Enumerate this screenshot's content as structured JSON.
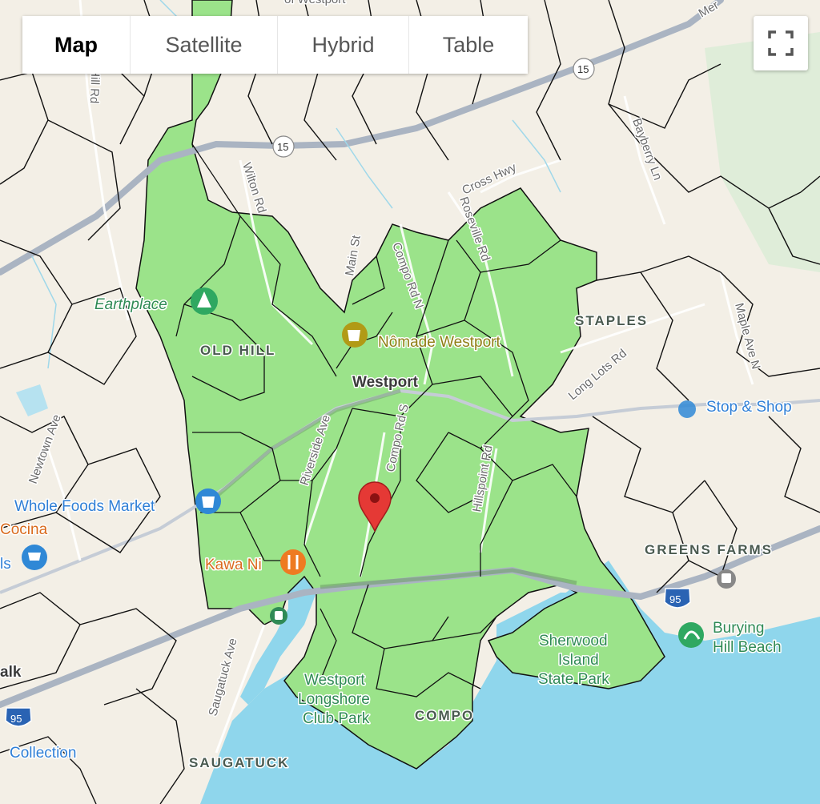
{
  "map_type_control": {
    "tabs": [
      {
        "label": "Map",
        "active": true
      },
      {
        "label": "Satellite",
        "active": false
      },
      {
        "label": "Hybrid",
        "active": false
      },
      {
        "label": "Table",
        "active": false
      }
    ]
  },
  "fullscreen": {
    "icon": "fullscreen-icon"
  },
  "colors": {
    "land": "#f3efe6",
    "water": "#8fd6ec",
    "selected_region": "#9be38a",
    "boundary": "#111111",
    "highway": "#aab4c2",
    "marker": "#e53935",
    "poi_blue": "#2f7fd6",
    "poi_orange": "#d96a1c",
    "poi_olive": "#8f7e14",
    "park_text": "#2f8a55"
  },
  "labels": {
    "areas": {
      "old_hill": "OLD HILL",
      "staples": "STAPLES",
      "greens_farms": "GREENS FARMS",
      "compo": "COMPO",
      "saugatuck": "SAUGATUCK",
      "westport": "Westport",
      "norwalk": "alk"
    },
    "roads": {
      "chestnut_hill": "estnut Hill Rd",
      "wilton": "Wilton Rd",
      "main": "Main St",
      "compo_n": "Compo Rd N",
      "roseville": "Roseville Rd",
      "cross_hwy": "Cross Hwy",
      "bayberry": "Bayberry Ln",
      "long_lots": "Long Lots Rd",
      "maple": "Maple Ave N",
      "newtown": "Newtown Ave",
      "riverside": "Riverside Ave",
      "compo_s": "Compo Rd S",
      "hillspoint": "Hillspoint Rd",
      "saugatuck_ave": "Saugatuck Ave",
      "route15_a": "15",
      "route15_b": "15",
      "i95": "95",
      "i95_b": "95",
      "merritt": "Mer",
      "top_westport": "of Westport"
    },
    "parks": {
      "earthplace": "Earthplace",
      "sherwood_1": "Sherwood",
      "sherwood_2": "Island",
      "sherwood_3": "State Park",
      "longshore_1": "Westport",
      "longshore_2": "Longshore",
      "longshore_3": "Club Park",
      "burying_1": "Burying",
      "burying_2": "Hill Beach"
    },
    "pois": {
      "whole_foods": "Whole Foods Market",
      "cocina": "Cocina",
      "ls": "ls",
      "kawa": "Kawa Ni",
      "nomade": "Nômade Westport",
      "stop_shop": "Stop & Shop",
      "collection": "Collection"
    }
  }
}
